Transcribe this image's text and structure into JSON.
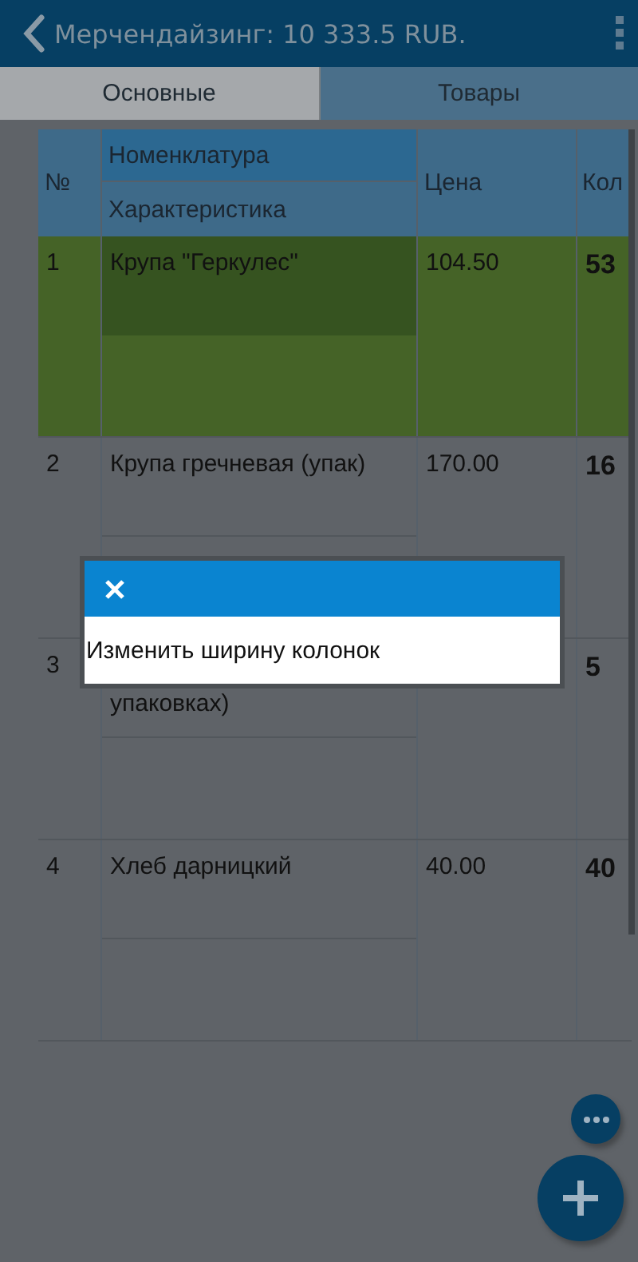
{
  "header": {
    "title": "Мерчендайзинг: 10 333.5 RUB."
  },
  "tabs": [
    {
      "label": "Основные",
      "selected": true
    },
    {
      "label": "Товары",
      "selected": false
    }
  ],
  "table": {
    "columns": {
      "number": "№",
      "name": "Номенклатура",
      "characteristic": "Характеристика",
      "price": "Цена",
      "column_4": "Кол"
    },
    "rows": [
      {
        "number": "1",
        "name": "Крупа \"Геркулес\"",
        "price": "104.50",
        "quantity": "53",
        "selected": true
      },
      {
        "number": "2",
        "name": "Крупа гречневая (упак)",
        "price": "170.00",
        "quantity": "16",
        "selected": false
      },
      {
        "number": "3",
        "name": "упаковках)",
        "quantity": "5",
        "selected": false
      },
      {
        "number": "4",
        "name": "Хлеб дарницкий",
        "price": "40.00",
        "quantity": "40",
        "selected": false
      }
    ]
  },
  "dialog": {
    "items": [
      "Изменить ширину колонок"
    ]
  }
}
